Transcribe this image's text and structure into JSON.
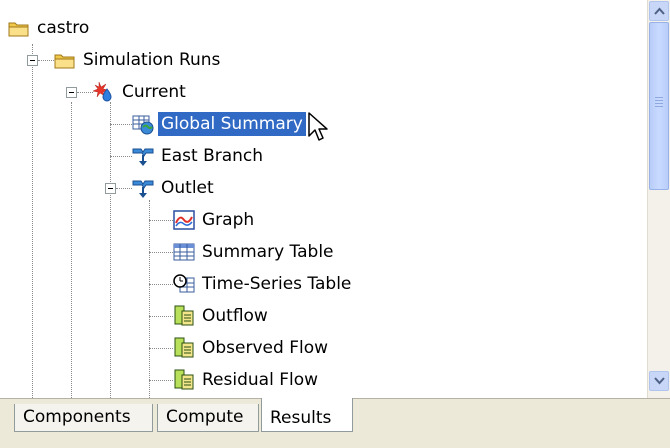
{
  "tree": {
    "nodes": [
      {
        "label": "castro",
        "icon": "folder-open-icon"
      },
      {
        "label": "Simulation Runs",
        "icon": "folder-open-icon"
      },
      {
        "label": "Current",
        "icon": "simulation-run-icon"
      },
      {
        "label": "Global Summary",
        "icon": "global-summary-icon",
        "selected": true
      },
      {
        "label": "East Branch",
        "icon": "junction-icon"
      },
      {
        "label": "Outlet",
        "icon": "junction-icon"
      },
      {
        "label": "Graph",
        "icon": "graph-icon"
      },
      {
        "label": "Summary Table",
        "icon": "summary-table-icon"
      },
      {
        "label": "Time-Series Table",
        "icon": "time-series-table-icon"
      },
      {
        "label": "Outflow",
        "icon": "time-series-data-icon"
      },
      {
        "label": "Observed Flow",
        "icon": "time-series-data-icon"
      },
      {
        "label": "Residual Flow",
        "icon": "time-series-data-icon"
      }
    ]
  },
  "tabs": [
    {
      "label": "Components",
      "active": false
    },
    {
      "label": "Compute",
      "active": false
    },
    {
      "label": "Results",
      "active": true
    }
  ],
  "colors": {
    "selection": "#316ac5",
    "folder": "#f0c84a",
    "background": "#ece9d8"
  }
}
